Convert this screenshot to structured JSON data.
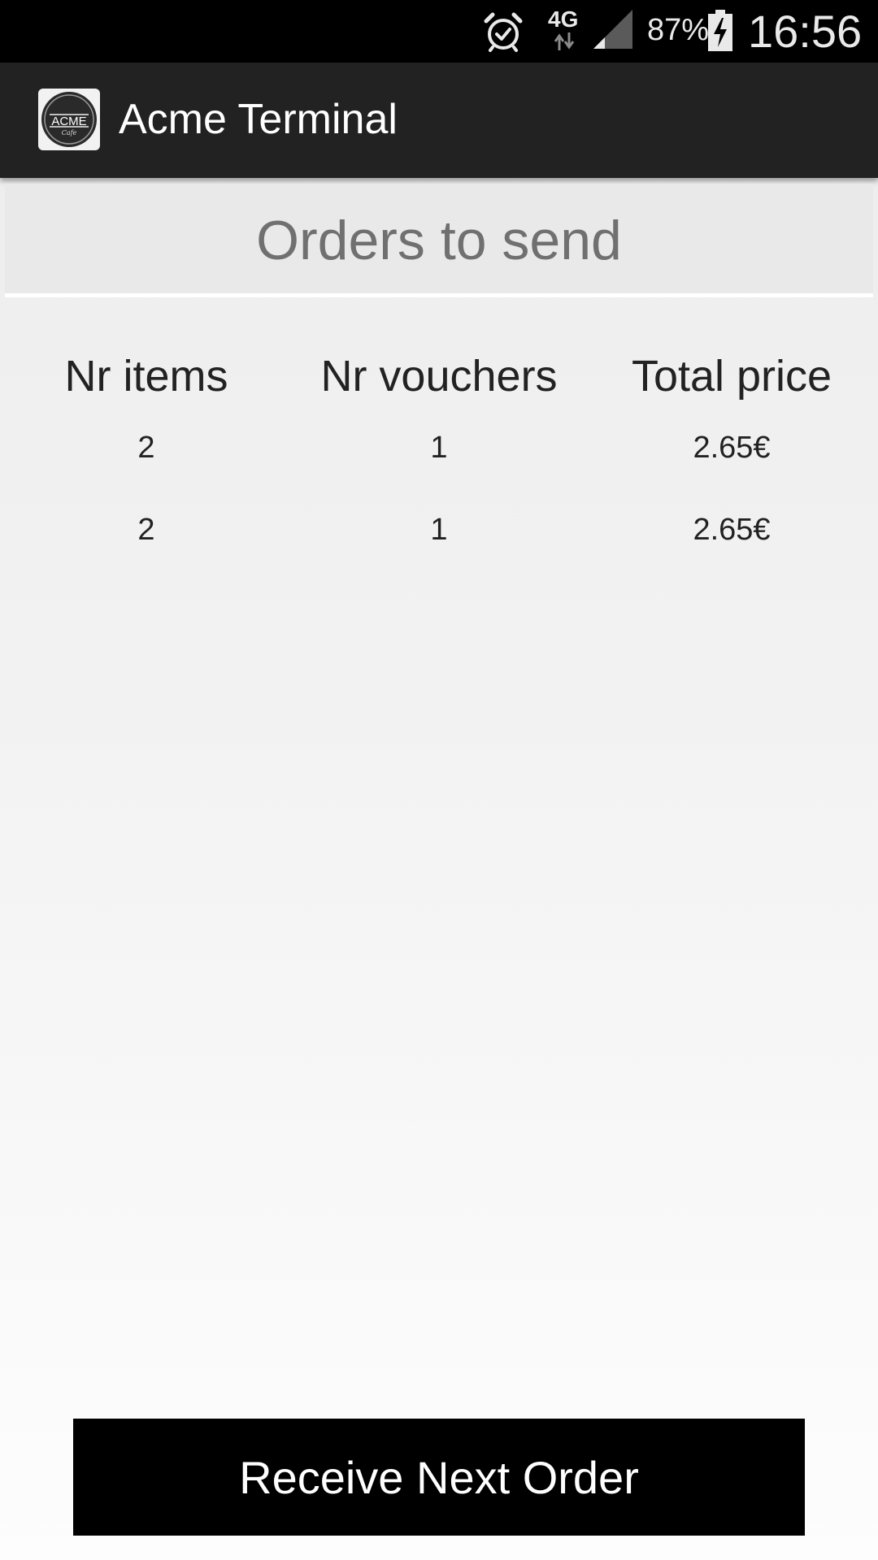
{
  "status_bar": {
    "network_type": "4G",
    "battery_percent": "87%",
    "time": "16:56",
    "icons": [
      "alarm-icon",
      "arrows-updown-icon",
      "signal-icon",
      "battery-charging-icon"
    ]
  },
  "app_bar": {
    "logo": {
      "name": "acme-logo-icon",
      "text": "ACME",
      "subtext": "Cafe"
    },
    "title": "Acme Terminal"
  },
  "header": {
    "title": "Orders to send"
  },
  "orders_table": {
    "columns": [
      "Nr items",
      "Nr vouchers",
      "Total price"
    ],
    "rows": [
      [
        "2",
        "1",
        "2.65€"
      ],
      [
        "2",
        "1",
        "2.65€"
      ]
    ]
  },
  "actions": {
    "receive_label": "Receive Next Order"
  },
  "colors": {
    "status_bar_bg": "#000000",
    "app_bar_bg": "#222222",
    "header_bg": "#e9e9e9",
    "header_text": "#707070",
    "button_bg": "#000000",
    "button_text": "#ffffff"
  }
}
